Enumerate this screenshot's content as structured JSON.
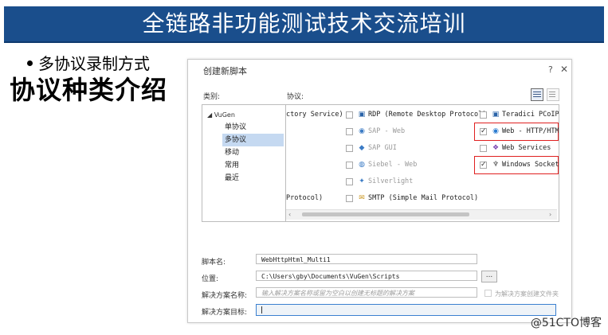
{
  "slide": {
    "title": "全链路非功能测试技术交流培训",
    "bullet": "多协议录制方式",
    "big_label": "协议种类介绍",
    "watermark": "@51CTO博客"
  },
  "dialog": {
    "title": "创建新脚本",
    "help": "?",
    "close": "✕",
    "category_label": "类别:",
    "protocol_label": "协议:",
    "categories": {
      "root": "◢ VuGen",
      "items": [
        "单协议",
        "多协议",
        "移动",
        "常用",
        "最近"
      ],
      "selected_index": 1
    },
    "left_cut_rows": [
      "ctory Service)",
      "Protocol)"
    ],
    "protocols_col1": [
      {
        "name": "RDP (Remote Desktop Protocol)",
        "checked": false,
        "enabled": true,
        "icon": "rdp-icon"
      },
      {
        "name": "SAP - Web",
        "checked": false,
        "enabled": false,
        "icon": "sap-web-icon"
      },
      {
        "name": "SAP GUI",
        "checked": false,
        "enabled": false,
        "icon": "sap-gui-icon"
      },
      {
        "name": "Siebel - Web",
        "checked": false,
        "enabled": false,
        "icon": "siebel-icon"
      },
      {
        "name": "Silverlight",
        "checked": false,
        "enabled": false,
        "icon": "silverlight-icon"
      },
      {
        "name": "SMTP (Simple Mail Protocol)",
        "checked": false,
        "enabled": true,
        "icon": "smtp-icon"
      }
    ],
    "protocols_col2": [
      {
        "name": "Teradici PCoIP",
        "checked": false,
        "enabled": true,
        "icon": "teradici-icon"
      },
      {
        "name": "Web - HTTP/HTML",
        "checked": true,
        "enabled": true,
        "icon": "web-icon",
        "highlight": true
      },
      {
        "name": "Web Services",
        "checked": false,
        "enabled": true,
        "icon": "web-services-icon"
      },
      {
        "name": "Windows Sockets",
        "checked": true,
        "enabled": true,
        "icon": "sockets-icon",
        "highlight": true
      }
    ],
    "script_name_label": "脚本名:",
    "script_name_value": "WebHttpHtml_Multi1",
    "location_label": "位置:",
    "location_value": "C:\\Users\\gby\\Documents\\VuGen\\Scripts",
    "browse_label": "...",
    "solution_name_label": "解决方案名称:",
    "solution_name_placeholder": "输入解决方案名称或留为空白以创建无标题的解决方案",
    "create_folder_label": "为解决方案创建文件夹",
    "solution_target_label": "解决方案目标:"
  },
  "colors": {
    "title_bar": "#1a4e8c",
    "highlight_border": "#e02020",
    "selected_category": "#c5d9f1"
  }
}
